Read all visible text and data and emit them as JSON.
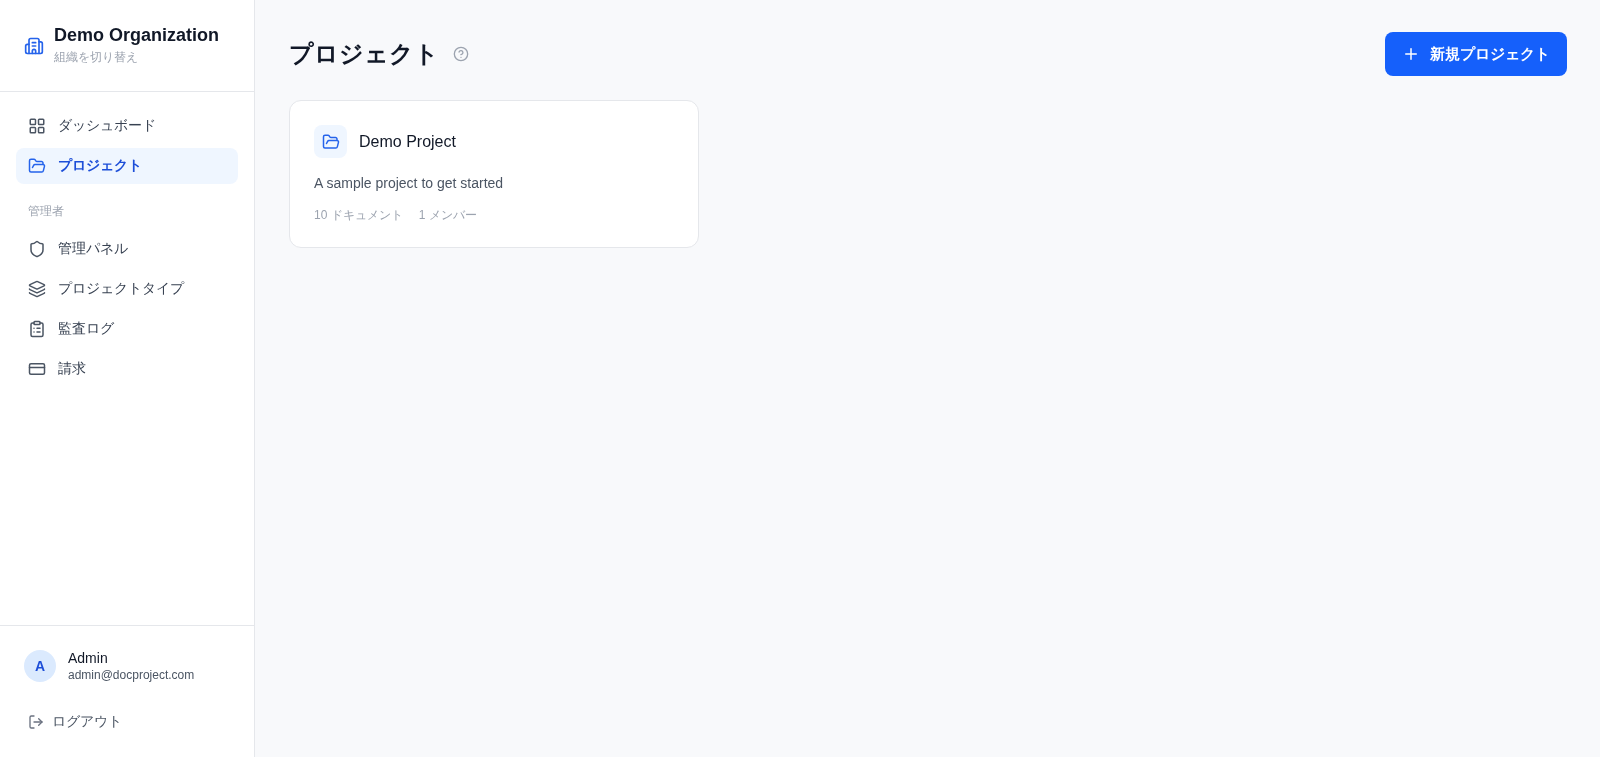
{
  "sidebar": {
    "org": {
      "name": "Demo Organization",
      "switch_label": "組織を切り替え"
    },
    "nav": [
      {
        "label": "ダッシュボード",
        "selected": false
      },
      {
        "label": "プロジェクト",
        "selected": true
      }
    ],
    "admin_section": {
      "title": "管理者",
      "items": [
        {
          "label": "管理パネル",
          "selected": false
        },
        {
          "label": "プロジェクトタイプ",
          "selected": false
        },
        {
          "label": "監査ログ",
          "selected": false
        },
        {
          "label": "請求",
          "selected": false
        }
      ]
    },
    "user": {
      "initial": "A",
      "name": "Admin",
      "email": "admin@docproject.com"
    },
    "logout": "ログアウト"
  },
  "main": {
    "title": "プロジェクト",
    "new_button": "新規プロジェクト",
    "projects": [
      {
        "name": "Demo Project",
        "description": "A sample project to get started",
        "documents": "10 ドキュメント",
        "members": "1 メンバー"
      }
    ]
  }
}
